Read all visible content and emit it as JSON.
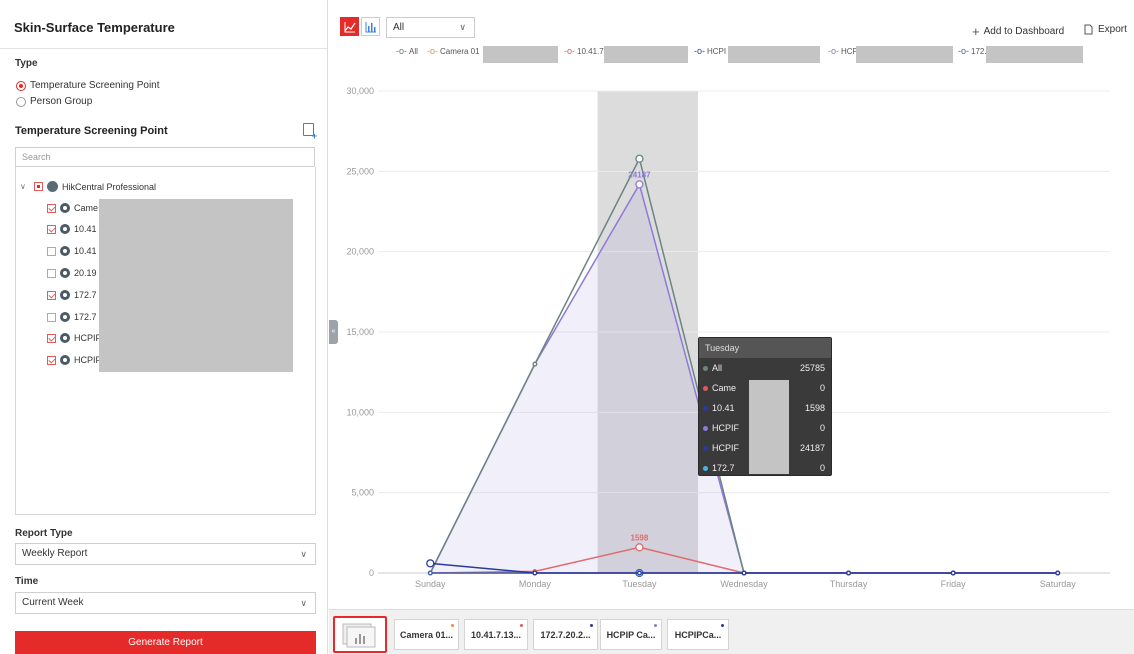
{
  "left": {
    "title": "Skin-Surface Temperature",
    "type_label": "Type",
    "type_options": [
      "Temperature Screening Point",
      "Person Group"
    ],
    "selected_type": "Temperature Screening Point",
    "tsp_title": "Temperature Screening Point",
    "search_placeholder": "Search",
    "tree": {
      "root": "HikCentral Professional",
      "items": [
        {
          "label": "Came",
          "checked": true
        },
        {
          "label": "10.41",
          "checked": true
        },
        {
          "label": "10.41",
          "checked": false
        },
        {
          "label": "20.19",
          "checked": false
        },
        {
          "label": "172.7",
          "checked": true
        },
        {
          "label": "172.7",
          "checked": false
        },
        {
          "label": "HCPIF",
          "checked": true
        },
        {
          "label": "HCPIF",
          "checked": true
        }
      ]
    },
    "report_type_label": "Report Type",
    "report_type_value": "Weekly Report",
    "time_label": "Time",
    "time_value": "Current Week",
    "generate_label": "Generate Report"
  },
  "toolbar": {
    "filter_value": "All",
    "add_dashboard": "Add to Dashboard",
    "export": "Export"
  },
  "legend": [
    {
      "label": "All",
      "color": "#5f7a78"
    },
    {
      "label": "Camera 01",
      "color": "#f08a3c"
    },
    {
      "label": "10.41.7",
      "color": "#e05a5a"
    },
    {
      "label": "HCPI",
      "color": "#2c3f9a"
    },
    {
      "label": "HCP",
      "color": "#8a73d6"
    },
    {
      "label": "172.",
      "color": "#3a5fb8"
    }
  ],
  "chart_data": {
    "type": "line",
    "categories": [
      "Sunday",
      "Monday",
      "Tuesday",
      "Wednesday",
      "Thursday",
      "Friday",
      "Saturday"
    ],
    "ylim": [
      0,
      30000
    ],
    "yticks": [
      "0",
      "5,000",
      "10,000",
      "15,000",
      "20,000",
      "25,000",
      "30,000"
    ],
    "highlight_category": "Tuesday",
    "series": [
      {
        "name": "All",
        "color": "#6b8583",
        "values": [
          0,
          13000,
          25785,
          0,
          0,
          0,
          0
        ]
      },
      {
        "name": "Camera 01",
        "color": "#f08a3c",
        "values": [
          0,
          0,
          0,
          0,
          0,
          0,
          0
        ]
      },
      {
        "name": "10.41.7",
        "color": "#e06b6b",
        "values": [
          0,
          100,
          1598,
          0,
          0,
          0,
          0
        ]
      },
      {
        "name": "HCPI",
        "color": "#2a3aa0",
        "values": [
          600,
          0,
          0,
          0,
          0,
          0,
          0
        ]
      },
      {
        "name": "HCP",
        "color": "#8e7ad8",
        "values": [
          0,
          13000,
          24187,
          0,
          0,
          0,
          0
        ],
        "fill": true
      },
      {
        "name": "172.",
        "color": "#3a5fb8",
        "values": [
          0,
          0,
          0,
          0,
          0,
          0,
          0
        ]
      }
    ],
    "data_labels": [
      {
        "series": "HCP",
        "category": "Tuesday",
        "text": "24187"
      },
      {
        "series": "10.41.7",
        "category": "Tuesday",
        "text": "1598"
      }
    ]
  },
  "tooltip": {
    "title": "Tuesday",
    "rows": [
      {
        "label": "All",
        "value": "25785",
        "color": "#6b8583"
      },
      {
        "label": "Came",
        "value": "0",
        "color": "#e05a5a"
      },
      {
        "label": "10.41",
        "value": "1598",
        "color": "#2a3aa0"
      },
      {
        "label": "HCPIF",
        "value": "0",
        "color": "#8e7ad8"
      },
      {
        "label": "HCPIF",
        "value": "24187",
        "color": "#2a3aa0"
      },
      {
        "label": "172.7",
        "value": "0",
        "color": "#4fb0e8"
      }
    ]
  },
  "thumbnails": [
    {
      "label": "Camera 01...",
      "dot": "#f08a3c"
    },
    {
      "label": "10.41.7.13...",
      "dot": "#e05a5a"
    },
    {
      "label": "172.7.20.2...",
      "dot": "#2a3aa0"
    },
    {
      "label": "HCPIP Ca...",
      "dot": "#8e7ad8"
    },
    {
      "label": "HCPIPCa...",
      "dot": "#2a3aa0"
    }
  ]
}
